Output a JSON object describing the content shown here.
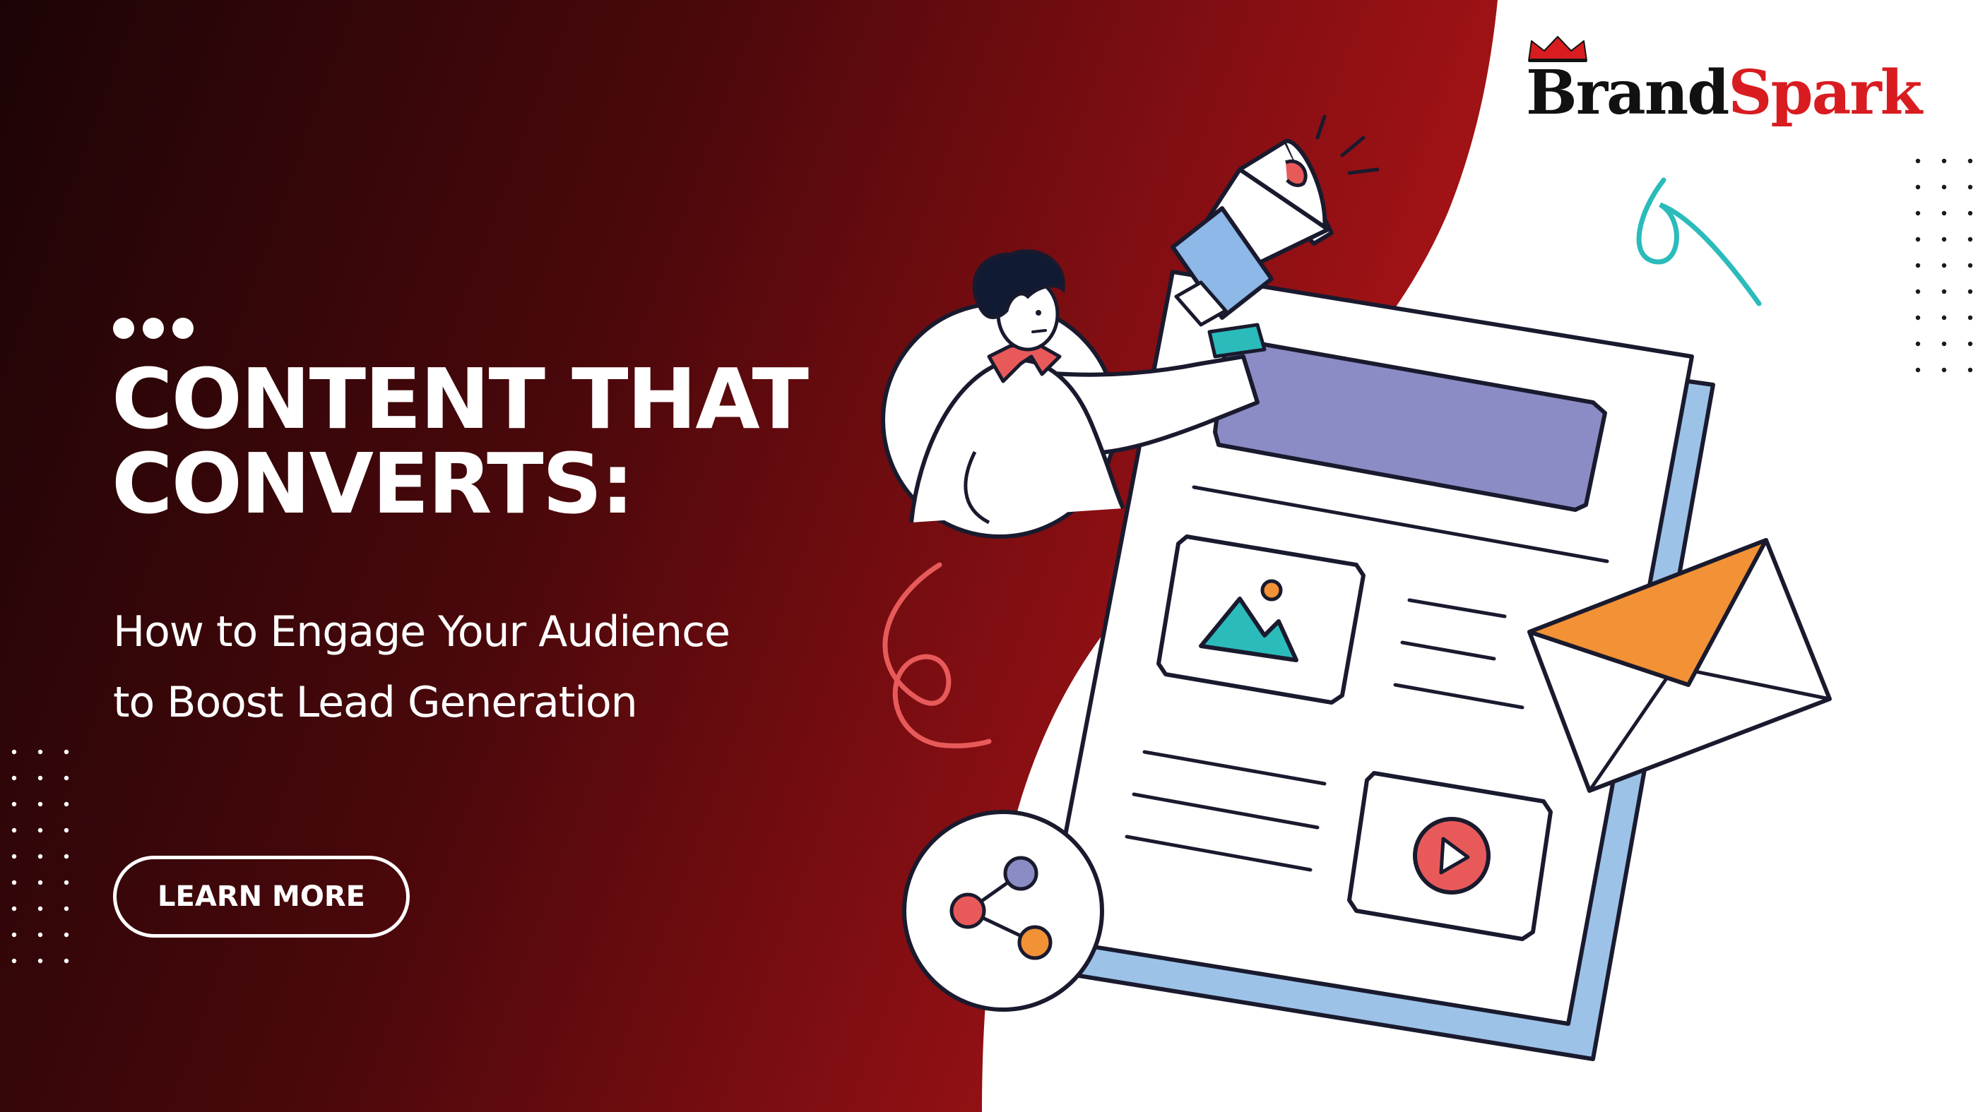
{
  "colors": {
    "accent_red": "#d41b1d",
    "dark_red": "#1c0406",
    "white": "#ffffff",
    "purple_bar": "#8b8cc6",
    "teal": "#2bbbbb",
    "orange": "#f29135",
    "coral": "#e85a5a",
    "light_blue": "#9cc2e8",
    "navy_outline": "#1a1a2e"
  },
  "logo": {
    "brand": "Brand",
    "spark": "Spark",
    "icon": "crown-icon"
  },
  "hero": {
    "headline_line1": "CONTENT THAT",
    "headline_line2": "CONVERTS:",
    "subheadline_line1": "How to Engage Your Audience",
    "subheadline_line2": "to Boost Lead Generation",
    "cta_label": "LEARN MORE"
  },
  "illustration": {
    "icons": [
      "megaphone-icon",
      "person-icon",
      "document-icon",
      "image-icon",
      "play-button-icon",
      "envelope-icon",
      "share-icon"
    ]
  }
}
